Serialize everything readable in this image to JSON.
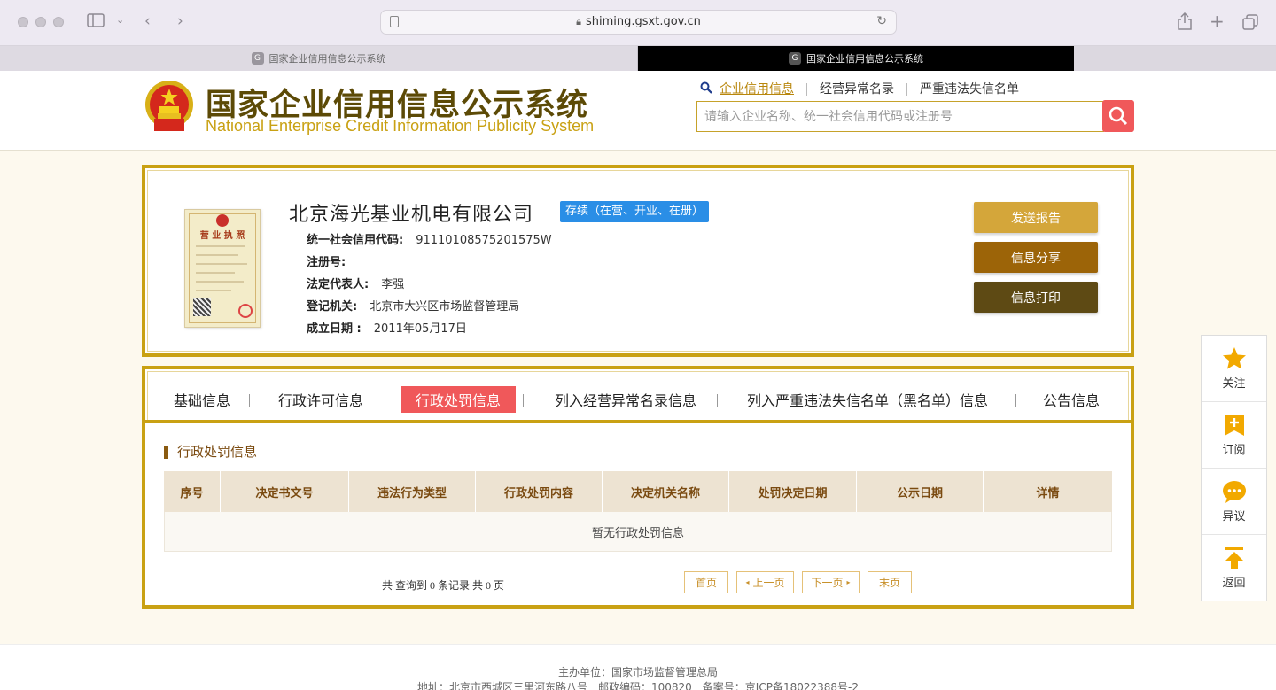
{
  "browser": {
    "url": "shiming.gsxt.gov.cn",
    "tabs": [
      {
        "label": "国家企业信用信息公示系统",
        "favicon": "G"
      },
      {
        "label": "国家企业信用信息公示系统",
        "favicon": "G"
      }
    ]
  },
  "header": {
    "title_cn": "国家企业信用信息公示系统",
    "title_en": "National Enterprise Credit Information Publicity System",
    "search_tabs": [
      "企业信用信息",
      "经营异常名录",
      "严重违法失信名单"
    ],
    "search_placeholder": "请输入企业名称、统一社会信用代码或注册号"
  },
  "company": {
    "name": "北京海光基业机电有限公司",
    "status": "存续（在营、开业、在册）",
    "license_title": "营 业 执 照",
    "fields": [
      {
        "label": "统一社会信用代码:",
        "value": "91110108575201575W"
      },
      {
        "label": "注册号:",
        "value": ""
      },
      {
        "label": "法定代表人:",
        "value": "李强"
      },
      {
        "label": "登记机关:",
        "value": "北京市大兴区市场监督管理局"
      },
      {
        "label": "成立日期 :",
        "value": "2011年05月17日"
      }
    ],
    "actions": [
      {
        "label": "发送报告",
        "color": "#d4a63a"
      },
      {
        "label": "信息分享",
        "color": "#9c6408"
      },
      {
        "label": "信息打印",
        "color": "#5e4a14"
      }
    ]
  },
  "nav": {
    "items": [
      "基础信息",
      "行政许可信息",
      "行政处罚信息",
      "列入经营异常名录信息",
      "列入严重违法失信名单（黑名单）信息",
      "公告信息"
    ],
    "active_index": 2
  },
  "section": {
    "title": "行政处罚信息",
    "columns": [
      "序号",
      "决定书文号",
      "违法行为类型",
      "行政处罚内容",
      "决定机关名称",
      "处罚决定日期",
      "公示日期",
      "详情"
    ],
    "empty_text": "暂无行政处罚信息"
  },
  "pagination": {
    "summary": "共 查询到 0 条记录 共 0 页",
    "first": "首页",
    "prev": "上一页",
    "next": "下一页",
    "last": "末页"
  },
  "side_panel": [
    {
      "label": "关注",
      "icon": "star-icon"
    },
    {
      "label": "订阅",
      "icon": "subscribe-icon"
    },
    {
      "label": "异议",
      "icon": "comment-icon"
    },
    {
      "label": "返回",
      "icon": "back-to-top-icon"
    }
  ],
  "footer": {
    "line1": "主办单位：国家市场监督管理总局",
    "line2": "地址：北京市西城区三里河东路八号　邮政编码：100820　备案号：京ICP备18022388号-2"
  },
  "colors": {
    "gold": "#c9a113",
    "active_tab": "#f0585a",
    "status_badge": "#2a8ee6",
    "side_icon": "#f2a900"
  }
}
